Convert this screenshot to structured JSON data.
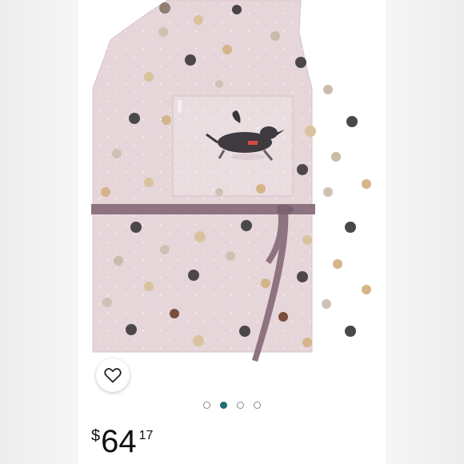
{
  "product": {
    "image_description_icon": "dog-print-apron-image"
  },
  "favorite": {
    "icon": "heart-outline-icon"
  },
  "carousel": {
    "count": 4,
    "active_index": 1
  },
  "price": {
    "currency_symbol": "$",
    "dollars": "64",
    "cents": "17"
  },
  "colors": {
    "apron": "#e6d6d9",
    "strap": "#8e7380",
    "accent": "#1e6e76"
  }
}
